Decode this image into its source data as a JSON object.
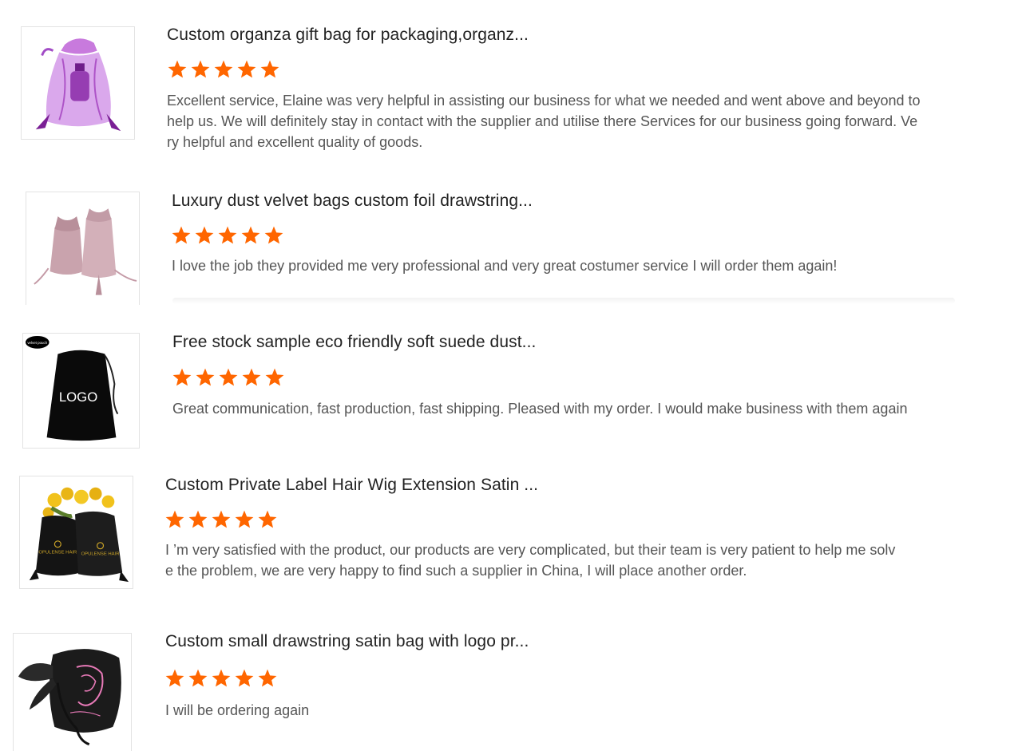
{
  "reviews": [
    {
      "title": "Custom organza gift bag for packaging,organz...",
      "rating": 5,
      "text": "Excellent service, Elaine was very helpful in assisting our business for what we needed and went above and beyond to help us. We will definitely stay in contact with the supplier and utilise there Services for our business going forward. Very helpful and excellent quality of goods."
    },
    {
      "title": "Luxury dust velvet bags custom foil drawstring...",
      "rating": 5,
      "text": "I love the job they provided me very professional and very great costumer service  I will order them again!"
    },
    {
      "title": "Free stock sample eco friendly soft suede dust...",
      "rating": 5,
      "text": "Great communication, fast production, fast shipping. Pleased with my order. I would make business with them again",
      "image_labels": [
        "velvet pouch",
        "LOGO"
      ]
    },
    {
      "title": "Custom Private Label Hair Wig Extension Satin ...",
      "rating": 5,
      "text": "I ’m very satisfied with the product, our products are very complicated, but their team is very patient to help me solve the problem, we are very happy to find such a supplier in China, I will place another order.",
      "image_labels": [
        "OPULENSE HAIR",
        "OPULENSE HAIR"
      ]
    },
    {
      "title": "Custom small drawstring satin bag with logo pr...",
      "rating": 5,
      "text": "I will be ordering again"
    }
  ],
  "colors": {
    "star": "#ff6600",
    "text": "#555555",
    "title": "#222222"
  }
}
